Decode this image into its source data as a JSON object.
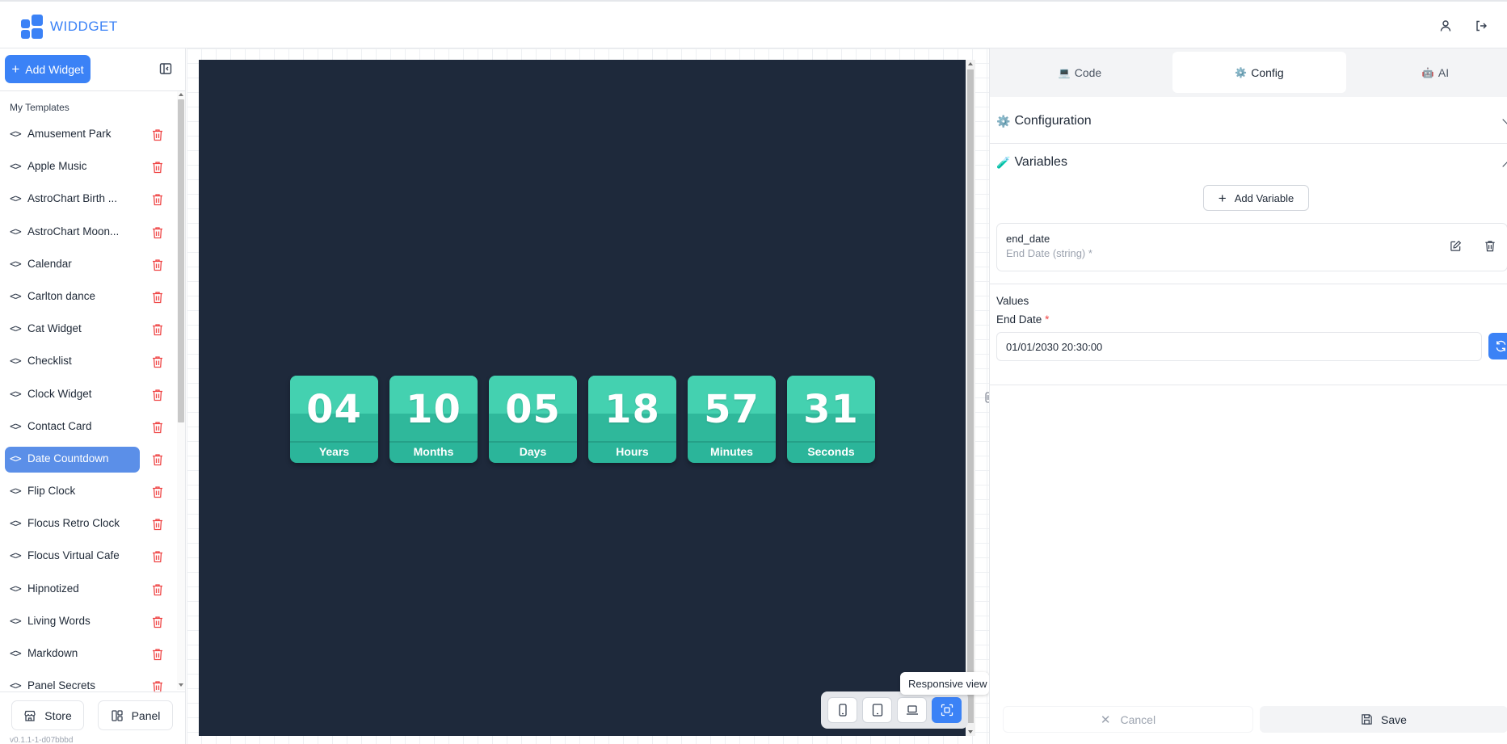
{
  "app": {
    "logo_text": "WIDDGET"
  },
  "sidebar": {
    "add_widget_label": "Add Widget",
    "section_title": "My Templates",
    "templates": [
      {
        "label": "Amusement Park"
      },
      {
        "label": "Apple Music"
      },
      {
        "label": "AstroChart Birth ..."
      },
      {
        "label": "AstroChart Moon..."
      },
      {
        "label": "Calendar"
      },
      {
        "label": "Carlton dance"
      },
      {
        "label": "Cat Widget"
      },
      {
        "label": "Checklist"
      },
      {
        "label": "Clock Widget"
      },
      {
        "label": "Contact Card"
      },
      {
        "label": "Date Countdown",
        "active": true
      },
      {
        "label": "Flip Clock"
      },
      {
        "label": "Flocus Retro Clock"
      },
      {
        "label": "Flocus Virtual Cafe"
      },
      {
        "label": "Hipnotized"
      },
      {
        "label": "Living Words"
      },
      {
        "label": "Markdown"
      },
      {
        "label": "Panel Secrets"
      }
    ],
    "code_glyph": "<>",
    "store_label": "Store",
    "panel_label": "Panel",
    "version": "v0.1.1-1-d07bbbd"
  },
  "preview": {
    "countdown": [
      {
        "value": "04",
        "unit": "Years"
      },
      {
        "value": "10",
        "unit": "Months"
      },
      {
        "value": "05",
        "unit": "Days"
      },
      {
        "value": "18",
        "unit": "Hours"
      },
      {
        "value": "57",
        "unit": "Minutes"
      },
      {
        "value": "31",
        "unit": "Seconds"
      }
    ],
    "tooltip": "Responsive view",
    "active_view": "responsive"
  },
  "right_panel": {
    "tabs": [
      {
        "icon": "💻",
        "label": "Code"
      },
      {
        "icon": "⚙️",
        "label": "Config",
        "active": true
      },
      {
        "icon": "🤖",
        "label": "AI"
      }
    ],
    "configuration": {
      "icon": "⚙️",
      "title": "Configuration"
    },
    "variables": {
      "icon": "🧪",
      "title": "Variables",
      "add_label": "Add Variable"
    },
    "variable": {
      "name": "end_date",
      "desc": "End Date (string) *"
    },
    "values": {
      "title": "Values",
      "field_label": "End Date",
      "required_mark": "*",
      "field_value": "01/01/2030 20:30:00"
    },
    "cancel_label": "Cancel",
    "save_label": "Save"
  },
  "colors": {
    "accent": "#3b82f6",
    "preview_bg": "#1e293b",
    "card": "#2bb59a",
    "card_top": "#44d1b0",
    "danger": "#ef4444"
  }
}
